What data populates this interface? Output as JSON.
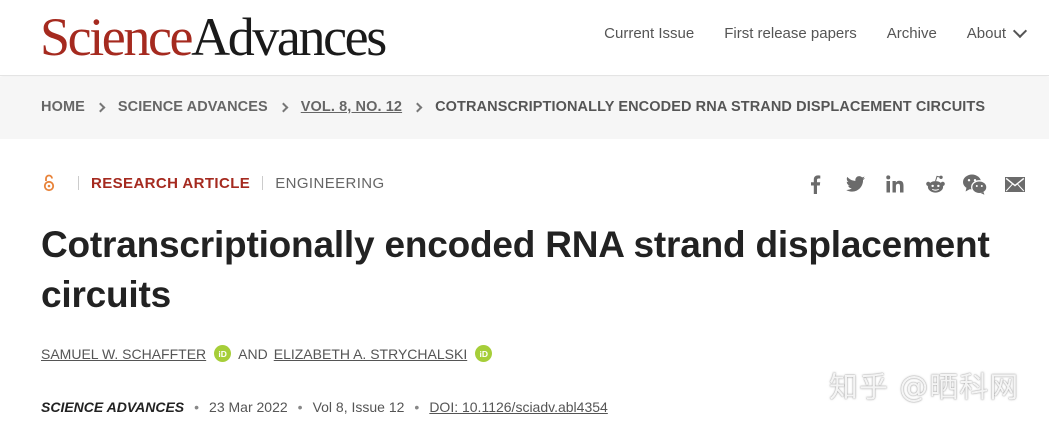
{
  "header": {
    "logo_part1": "Science",
    "logo_part2": "Advances",
    "nav": [
      "Current Issue",
      "First release papers",
      "Archive",
      "About"
    ]
  },
  "breadcrumb": {
    "items": [
      "HOME",
      "SCIENCE ADVANCES",
      "VOL. 8, NO. 12"
    ],
    "current": "COTRANSCRIPTIONALLY ENCODED RNA STRAND DISPLACEMENT CIRCUITS"
  },
  "article": {
    "type": "RESEARCH ARTICLE",
    "subject": "ENGINEERING",
    "title": "Cotranscriptionally encoded RNA strand displacement circuits",
    "authors": [
      "SAMUEL W. SCHAFFTER",
      "ELIZABETH A. STRYCHALSKI"
    ],
    "and_text": "AND",
    "orcid_label": "iD",
    "journal": "SCIENCE ADVANCES",
    "date": "23 Mar 2022",
    "volume": "Vol 8, Issue 12",
    "doi": "DOI: 10.1126/sciadv.abl4354"
  },
  "share_icons": [
    "facebook-icon",
    "twitter-icon",
    "linkedin-icon",
    "reddit-icon",
    "wechat-icon",
    "email-icon"
  ],
  "watermark": "知乎 @晒科网",
  "colors": {
    "brand_red": "#a52a1f",
    "orcid_green": "#a6ce39",
    "breadcrumb_bg": "#f6f6f6"
  }
}
